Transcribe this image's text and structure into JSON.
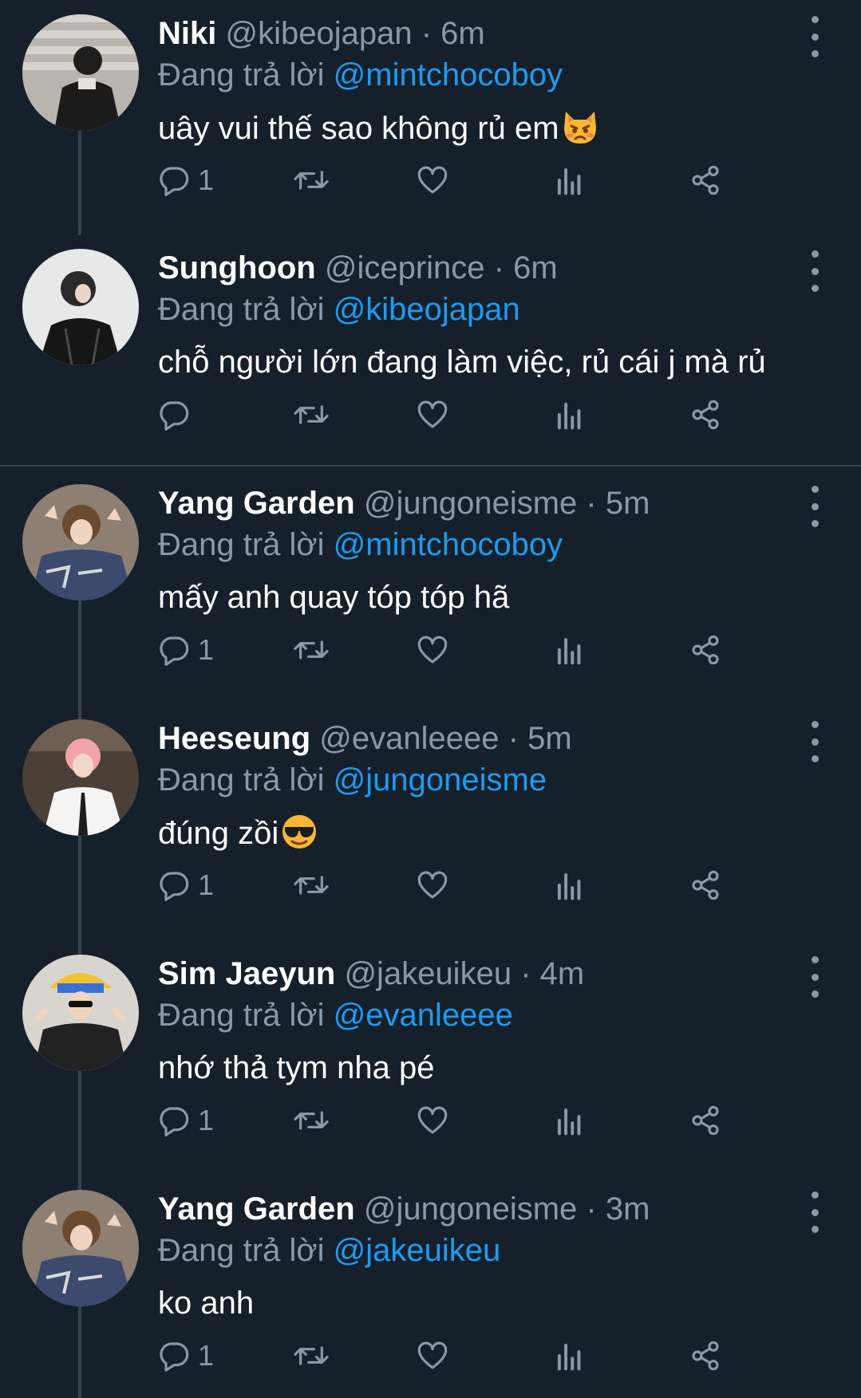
{
  "reply_prefix": "Đang trả lời",
  "colors": {
    "background": "#15202b",
    "muted": "#8b98a5",
    "accent": "#1d9bf0",
    "line": "#38444d"
  },
  "icons": [
    "reply-icon",
    "retweet-icon",
    "like-icon",
    "analytics-icon",
    "share-icon",
    "more-icon"
  ],
  "tweets": [
    {
      "name": "Niki",
      "handle": "@kibeojapan",
      "time": "6m",
      "reply_to": "@mintchocoboy",
      "text": "uây vui thế sao không rủ em",
      "emoji": "pouting-cat",
      "reply_count": "1"
    },
    {
      "name": "Sunghoon",
      "handle": "@iceprince",
      "time": "6m",
      "reply_to": "@kibeojapan",
      "text": "chỗ người lớn đang làm việc, rủ cái j mà rủ",
      "emoji": "",
      "reply_count": ""
    },
    {
      "name": "Yang Garden",
      "handle": "@jungoneisme",
      "time": "5m",
      "reply_to": "@mintchocoboy",
      "text": "mấy anh quay tóp tóp hã",
      "emoji": "",
      "reply_count": "1"
    },
    {
      "name": "Heeseung",
      "handle": "@evanleeee",
      "time": "5m",
      "reply_to": "@jungoneisme",
      "text": "đúng zồi",
      "emoji": "sunglasses-face",
      "reply_count": "1"
    },
    {
      "name": "Sim Jaeyun",
      "handle": "@jakeuikeu",
      "time": "4m",
      "reply_to": "@evanleeee",
      "text": "nhớ thả tym nha pé",
      "emoji": "",
      "reply_count": "1"
    },
    {
      "name": "Yang Garden",
      "handle": "@jungoneisme",
      "time": "3m",
      "reply_to": "@jakeuikeu",
      "text": "ko anh",
      "emoji": "",
      "reply_count": "1"
    }
  ]
}
